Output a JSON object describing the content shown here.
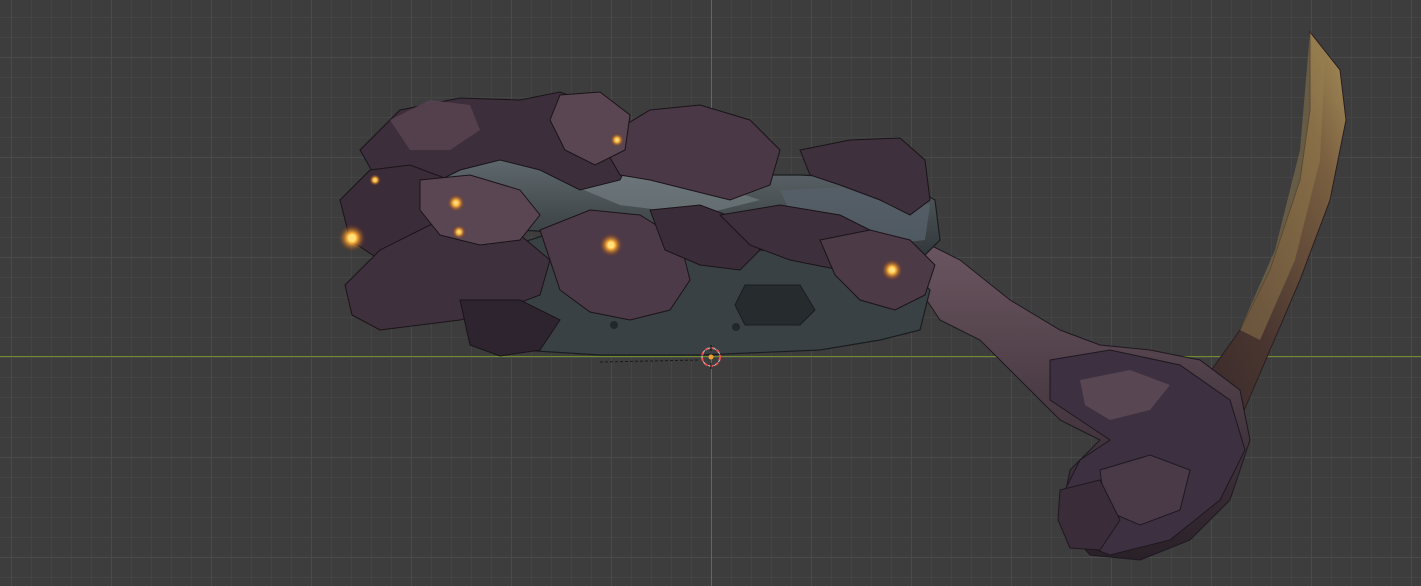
{
  "viewport": {
    "background_color": "#3d3d3d",
    "grid_minor_color": "#444444",
    "grid_major_color": "#4a4a4a",
    "axis_x_color": "#6e8b2a",
    "axis_z_color": "#3a6bb8"
  },
  "model": {
    "object": "creature-arm-mesh",
    "palette": {
      "flesh_dark": "#2e2430",
      "flesh_mid": "#4a3a48",
      "flesh_light": "#6b5660",
      "armor_dark": "#2f3437",
      "armor_mid": "#4b5357",
      "armor_light": "#6c777c",
      "claw_base": "#3b2a2c",
      "claw_tip": "#8a7048",
      "glow": "#ffb23a"
    }
  },
  "cursor": {
    "icon": "3d-cursor-icon",
    "ring_color": "#e85050",
    "center_color": "#f0a030"
  }
}
